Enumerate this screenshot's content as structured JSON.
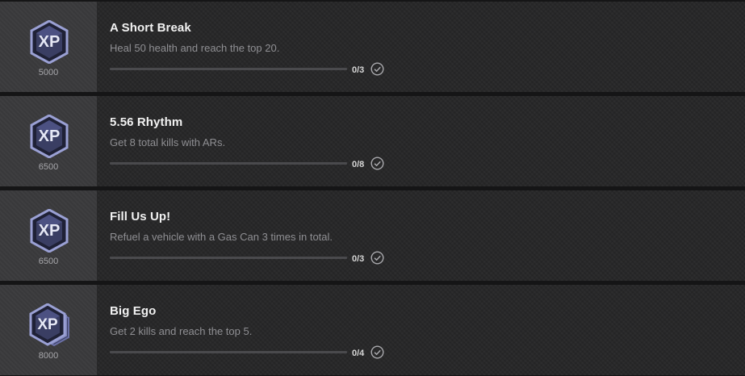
{
  "missions": [
    {
      "title": "A Short Break",
      "description": "Heal 50 health and reach the top 20.",
      "xp": "5000",
      "progress_text": "0/3",
      "progress": 0,
      "badge_icon": "xp-icon"
    },
    {
      "title": "5.56 Rhythm",
      "description": "Get 8 total kills with ARs.",
      "xp": "6500",
      "progress_text": "0/8",
      "progress": 0,
      "badge_icon": "xp-icon"
    },
    {
      "title": "Fill Us Up!",
      "description": "Refuel a vehicle with a Gas Can 3 times in total.",
      "xp": "6500",
      "progress_text": "0/3",
      "progress": 0,
      "badge_icon": "xp-icon"
    },
    {
      "title": "Big Ego",
      "description": "Get 2 kills and reach the top 5.",
      "xp": "8000",
      "progress_text": "0/4",
      "progress": 0,
      "badge_icon": "xp-stacked-icon"
    }
  ],
  "colors": {
    "badge_dark": "#2c2f48",
    "badge_light": "#8d93c8",
    "badge_text": "#e6e8f5"
  }
}
